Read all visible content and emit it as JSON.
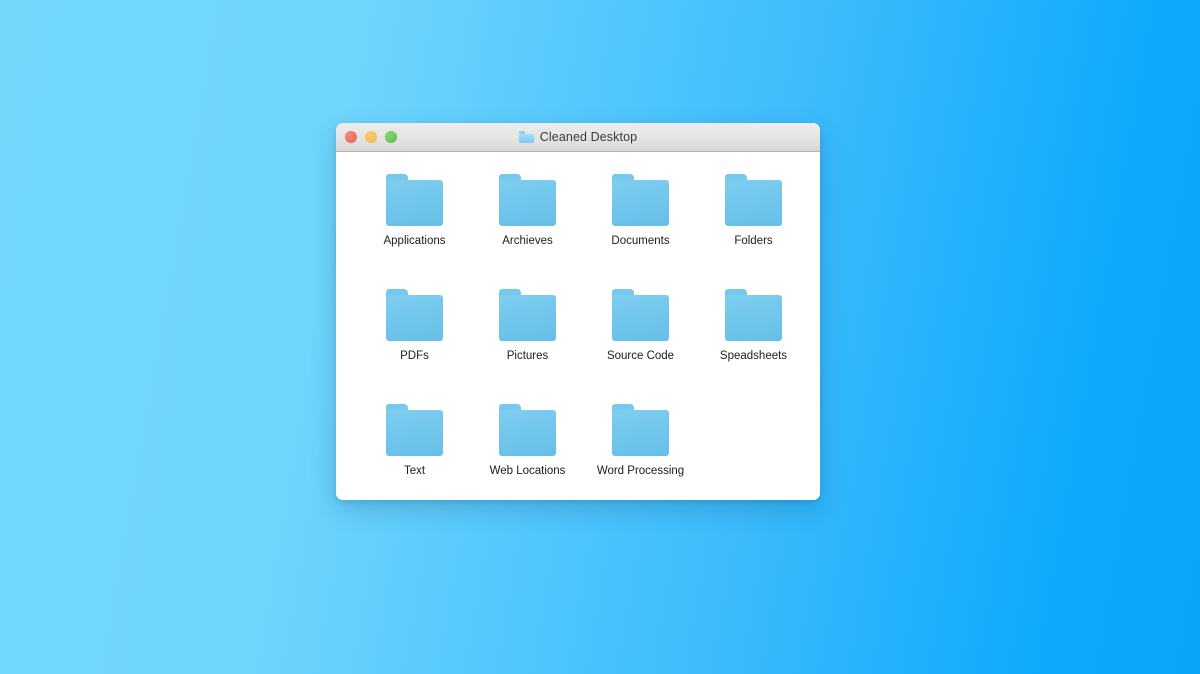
{
  "desktop": {
    "background_start_color": "#72d9fd",
    "background_end_color": "#0aa4fa"
  },
  "window": {
    "title": "Cleaned Desktop",
    "title_icon": "folder-icon",
    "controls": {
      "close_label": "Close",
      "minimize_label": "Minimize",
      "maximize_label": "Maximize",
      "close_color": "#ec6a5e",
      "minimize_color": "#f4bd4f",
      "maximize_color": "#61c554"
    },
    "folder_color": "#74c8ed",
    "rows": [
      {
        "items": [
          {
            "label": "Applications",
            "icon": "folder-icon"
          },
          {
            "label": "Archieves",
            "icon": "folder-icon"
          },
          {
            "label": "Documents",
            "icon": "folder-icon"
          },
          {
            "label": "Folders",
            "icon": "folder-icon"
          }
        ]
      },
      {
        "items": [
          {
            "label": "PDFs",
            "icon": "folder-icon"
          },
          {
            "label": "Pictures",
            "icon": "folder-icon"
          },
          {
            "label": "Source Code",
            "icon": "folder-icon"
          },
          {
            "label": "Speadsheets",
            "icon": "folder-icon"
          }
        ]
      },
      {
        "items": [
          {
            "label": "Text",
            "icon": "folder-icon"
          },
          {
            "label": "Web Locations",
            "icon": "folder-icon"
          },
          {
            "label": "Word Processing",
            "icon": "folder-icon"
          }
        ]
      }
    ]
  }
}
